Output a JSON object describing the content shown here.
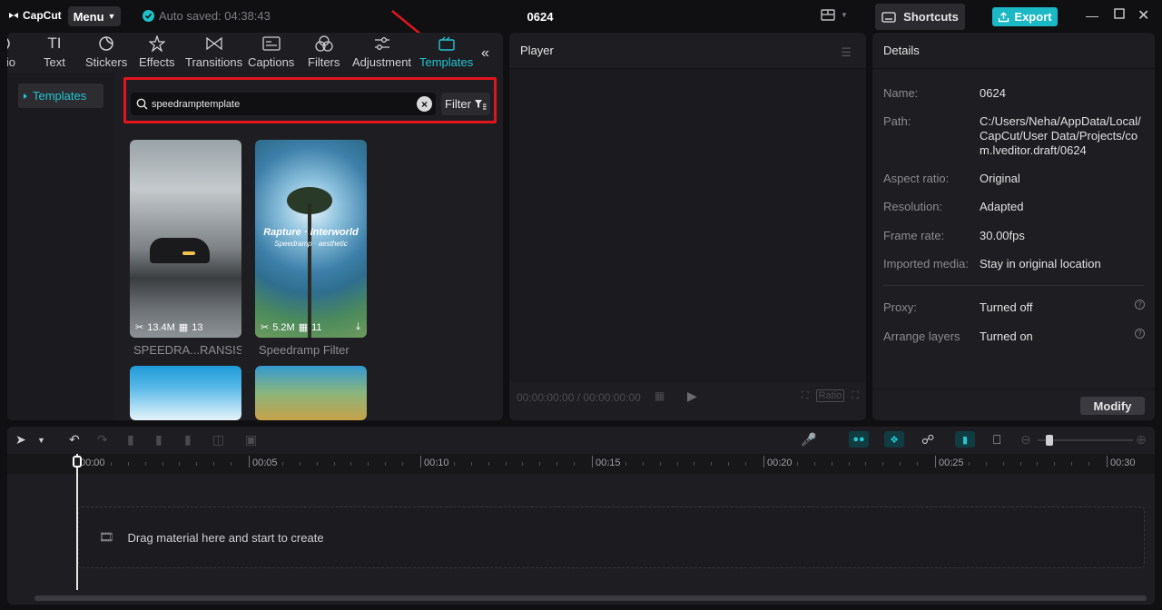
{
  "titlebar": {
    "app_name": "CapCut",
    "menu_label": "Menu",
    "autosave_text": "Auto saved: 04:38:43",
    "project_title": "0624",
    "shortcuts_label": "Shortcuts",
    "export_label": "Export"
  },
  "toolbar": {
    "items": [
      {
        "label": "lio",
        "icon": "audio-icon"
      },
      {
        "label": "Text",
        "icon": "text-icon"
      },
      {
        "label": "Stickers",
        "icon": "stickers-icon"
      },
      {
        "label": "Effects",
        "icon": "effects-icon"
      },
      {
        "label": "Transitions",
        "icon": "transitions-icon"
      },
      {
        "label": "Captions",
        "icon": "captions-icon"
      },
      {
        "label": "Filters",
        "icon": "filters-icon"
      },
      {
        "label": "Adjustment",
        "icon": "adjustment-icon"
      },
      {
        "label": "Templates",
        "icon": "templates-icon",
        "active": true
      }
    ]
  },
  "sidenav": {
    "item_label": "Templates"
  },
  "search": {
    "value": "speedramptemplate",
    "filter_label": "Filter"
  },
  "templates": [
    {
      "title": "SPEEDRA...RANSISI",
      "size": "13.4M",
      "clips": "13"
    },
    {
      "title": "Speedramp Filter",
      "size": "5.2M",
      "clips": "11",
      "overlay_title": "Rapture · Interworld",
      "overlay_sub": "Speedramp · aesthetic"
    }
  ],
  "player": {
    "title": "Player",
    "timecode": "00:00:00:00 / 00:00:00:00",
    "ratio_label": "Ratio"
  },
  "details": {
    "title": "Details",
    "rows": [
      {
        "key": "Name:",
        "value": "0624"
      },
      {
        "key": "Path:",
        "value": "C:/Users/Neha/AppData/Local/CapCut/User Data/Projects/com.lveditor.draft/0624"
      },
      {
        "key": "Aspect ratio:",
        "value": "Original"
      },
      {
        "key": "Resolution:",
        "value": "Adapted"
      },
      {
        "key": "Frame rate:",
        "value": "30.00fps"
      },
      {
        "key": "Imported media:",
        "value": "Stay in original location"
      },
      {
        "key": "Proxy:",
        "value": "Turned off"
      },
      {
        "key": "Arrange layers",
        "value": "Turned on"
      }
    ],
    "modify_label": "Modify"
  },
  "timeline": {
    "ticks": [
      "00:00",
      "00:05",
      "00:10",
      "00:15",
      "00:20",
      "00:25",
      "00:30"
    ],
    "drop_text": "Drag material here and start to create"
  },
  "colors": {
    "accent": "#22c4cf",
    "export": "#1bb8c6",
    "highlight": "#e0161c"
  }
}
